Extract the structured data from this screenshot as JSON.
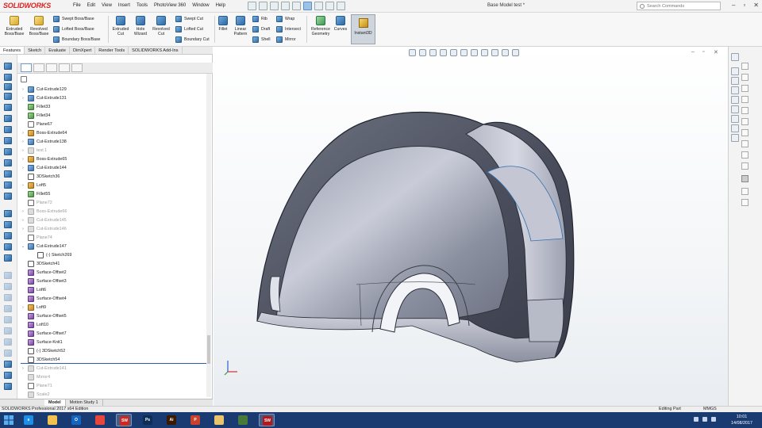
{
  "app": {
    "logo_text": "SOLIDWORKS",
    "document_title": "Base Model test *",
    "search_placeholder": "Search Commands"
  },
  "menu": [
    "File",
    "Edit",
    "View",
    "Insert",
    "Tools",
    "PhotoView 360",
    "Window",
    "Help"
  ],
  "commands": {
    "extruded_boss": "Extruded Boss/Base",
    "revolved_boss": "Revolved Boss/Base",
    "swept_boss": "Swept Boss/Base",
    "lofted_boss": "Lofted Boss/Base",
    "boundary_boss": "Boundary Boss/Base",
    "extruded_cut": "Extruded Cut",
    "hole_wizard": "Hole Wizard",
    "revolved_cut": "Revolved Cut",
    "swept_cut": "Swept Cut",
    "lofted_cut": "Lofted Cut",
    "boundary_cut": "Boundary Cut",
    "fillet": "Fillet",
    "linear_pattern": "Linear Pattern",
    "rib": "Rib",
    "draft": "Draft",
    "shell": "Shell",
    "wrap": "Wrap",
    "intersect": "Intersect",
    "mirror": "Mirror",
    "reference_geometry": "Reference Geometry",
    "curves": "Curves",
    "instant3d": "Instant3D"
  },
  "tabs": [
    "Features",
    "Sketch",
    "Evaluate",
    "DimXpert",
    "Render Tools",
    "SOLIDWORKS Add-Ins"
  ],
  "tree": [
    {
      "label": "Cut-Extrude129",
      "type": "cut",
      "expand": "›",
      "dim": false
    },
    {
      "label": "Cut-Extrude131",
      "type": "cut",
      "expand": "›",
      "dim": false
    },
    {
      "label": "Fillet33",
      "type": "fillet",
      "expand": "",
      "dim": false
    },
    {
      "label": "Fillet34",
      "type": "fillet",
      "expand": "",
      "dim": false
    },
    {
      "label": "Plane67",
      "type": "plane",
      "expand": "",
      "dim": false
    },
    {
      "label": "Boss-Extrude64",
      "type": "boss",
      "expand": "›",
      "dim": false
    },
    {
      "label": "Cut-Extrude138",
      "type": "cut",
      "expand": "›",
      "dim": false
    },
    {
      "label": "test 1",
      "type": "gray",
      "expand": "›",
      "dim": true
    },
    {
      "label": "Boss-Extrude65",
      "type": "boss",
      "expand": "›",
      "dim": false
    },
    {
      "label": "Cut-Extrude144",
      "type": "cut",
      "expand": "›",
      "dim": false
    },
    {
      "label": "3DSketch36",
      "type": "sketch",
      "expand": "",
      "dim": false
    },
    {
      "label": "Loft5",
      "type": "boss",
      "expand": "›",
      "dim": false
    },
    {
      "label": "Fillet55",
      "type": "fillet",
      "expand": "",
      "dim": false
    },
    {
      "label": "Plane72",
      "type": "plane",
      "expand": "",
      "dim": true
    },
    {
      "label": "Boss-Extrude66",
      "type": "gray",
      "expand": "›",
      "dim": true
    },
    {
      "label": "Cut-Extrude145",
      "type": "gray",
      "expand": "›",
      "dim": true
    },
    {
      "label": "Cut-Extrude146",
      "type": "gray",
      "expand": "›",
      "dim": true
    },
    {
      "label": "Plane74",
      "type": "plane",
      "expand": "",
      "dim": true
    },
    {
      "label": "Cut-Extrude147",
      "type": "cut",
      "expand": "⌄",
      "dim": false
    },
    {
      "label": "(-) Sketch269",
      "type": "sketch",
      "expand": "",
      "dim": false,
      "indent": true
    },
    {
      "label": "3DSketch41",
      "type": "sketch",
      "expand": "",
      "dim": false
    },
    {
      "label": "Surface-Offset2",
      "type": "surf",
      "expand": "",
      "dim": false
    },
    {
      "label": "Surface-Offset3",
      "type": "surf",
      "expand": "",
      "dim": false
    },
    {
      "label": "Loft6",
      "type": "surf",
      "expand": "",
      "dim": false
    },
    {
      "label": "Surface-Offset4",
      "type": "surf",
      "expand": "",
      "dim": false
    },
    {
      "label": "Loft9",
      "type": "boss",
      "expand": "›",
      "dim": false
    },
    {
      "label": "Surface-Offset5",
      "type": "surf",
      "expand": "",
      "dim": false
    },
    {
      "label": "Loft10",
      "type": "surf",
      "expand": "",
      "dim": false
    },
    {
      "label": "Surface-Offset7",
      "type": "surf",
      "expand": "",
      "dim": false
    },
    {
      "label": "Surface-Knit1",
      "type": "surf",
      "expand": "",
      "dim": false
    },
    {
      "label": "(-) 3DSketch52",
      "type": "sketch",
      "expand": "",
      "dim": false
    },
    {
      "label": "3DSketch54",
      "type": "sketch",
      "expand": "",
      "dim": false,
      "selected": true
    },
    {
      "label": "Cut-Extrude141",
      "type": "gray",
      "expand": "›",
      "dim": true
    },
    {
      "label": "Mirror4",
      "type": "gray",
      "expand": "",
      "dim": true
    },
    {
      "label": "Plane71",
      "type": "plane",
      "expand": "",
      "dim": true
    },
    {
      "label": "Scale2",
      "type": "gray",
      "expand": "",
      "dim": true
    }
  ],
  "model_tabs": [
    "Model",
    "Motion Study 1"
  ],
  "status": {
    "edition": "SOLIDWORKS Professional 2017 x64 Edition",
    "mode": "Editing Part",
    "units": "MMGS"
  },
  "clock": {
    "time": "10:01",
    "date": "14/08/2017"
  },
  "taskbar_apps": [
    {
      "name": "ie",
      "glyph": "e",
      "color": "#1e8ee6"
    },
    {
      "name": "explorer",
      "glyph": "",
      "color": "#f2c14e"
    },
    {
      "name": "outlook",
      "glyph": "O",
      "color": "#1565c0"
    },
    {
      "name": "chrome",
      "glyph": "",
      "color": "#e8453c"
    },
    {
      "name": "solidworks",
      "glyph": "SW",
      "color": "#d0281e"
    },
    {
      "name": "photoshop",
      "glyph": "Ps",
      "color": "#0d2f55"
    },
    {
      "name": "illustrator",
      "glyph": "Ai",
      "color": "#3b1b00"
    },
    {
      "name": "powerpoint",
      "glyph": "P",
      "color": "#c9422b"
    },
    {
      "name": "folder",
      "glyph": "",
      "color": "#e9c46a"
    },
    {
      "name": "app",
      "glyph": "",
      "color": "#4a7a3a"
    },
    {
      "name": "solidworks2",
      "glyph": "SW",
      "color": "#b4181a"
    }
  ]
}
